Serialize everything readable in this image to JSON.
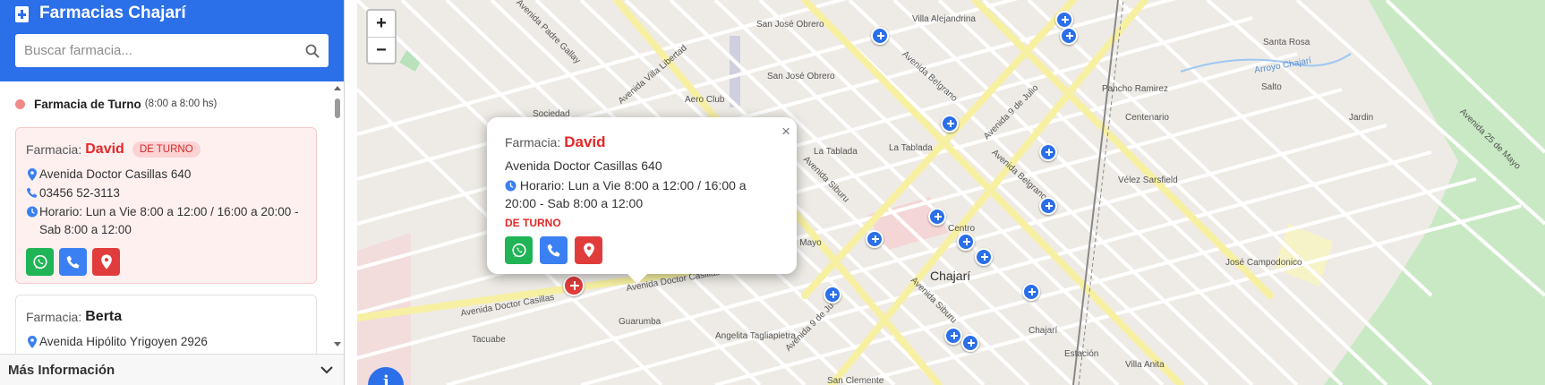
{
  "sidebar": {
    "title": "Farmacias Chajarí",
    "search_placeholder": "Buscar farmacia...",
    "legend": {
      "label": "Farmacia de Turno",
      "hours": "(8:00 a 8:00 hs)"
    },
    "cards": [
      {
        "prefix": "Farmacia:",
        "name": "David",
        "badge": "DE TURNO",
        "address": "Avenida Doctor Casillas 640",
        "phone": "03456 52-3113",
        "hours_line1": "Horario: Lun a Vie 8:00 a 12:00 / 16:00 a 20:00 -",
        "hours_line2": "Sab 8:00 a 12:00"
      },
      {
        "prefix": "Farmacia:",
        "name": "Berta",
        "address": "Avenida Hipólito Yrigoyen 2926"
      }
    ],
    "more_info": "Más Información"
  },
  "map": {
    "zoom_in": "+",
    "zoom_out": "−",
    "info_button": "i",
    "labels": {
      "villa_alejandrina": "Villa Alejandrina",
      "san_jose_obrero_1": "San José Obrero",
      "san_jose_obrero_2": "San José Obrero",
      "aero_club": "Aero Club",
      "sociedad": "Sociedad",
      "santa_rosa": "Santa Rosa",
      "pancho_ramirez": "Pancho Ramirez",
      "salto": "Salto",
      "jardin": "Jardin",
      "centenario": "Centenario",
      "velez": "Vélez Sarsfield",
      "la_tablada_1": "La Tablada",
      "la_tablada_2": "La Tablada",
      "centro": "Centro",
      "chajari": "Chajarí",
      "chajari_station": "Chajarí",
      "estacion": "Estación",
      "villa_anita": "Villa Anita",
      "jose_campodonico": "José Campodonico",
      "angelita": "Angelita Tagliapietra",
      "guarumba": "Guarumba",
      "san_clemente": "San Clemente",
      "primero_mayo": "1 de Mayo",
      "arroyo_chajari": "Arroyo Chajarí",
      "av_casillas_1": "Avenida Doctor Casillas",
      "av_casillas_2": "Avenida Doctor Casillas",
      "av_belgrano_1": "Avenida Belgrano",
      "av_belgrano_2": "Avenida Belgrano",
      "av_9_julio_1": "Avenida 9 de Julio",
      "av_9_julio_2": "Avenida 9 de Ju",
      "av_siburu_1": "Avenida Siburu",
      "av_siburu_2": "Avenida Siburu",
      "av_villa_libertad": "Avenida Villa Libertad",
      "av_25_mayo": "Avenida 25 de Mayo",
      "av_padre_gallay": "Avenida Padre Gallay",
      "tacuabe": "Tacuabe"
    },
    "popup": {
      "prefix": "Farmacia:",
      "name": "David",
      "address": "Avenida Doctor Casillas 640",
      "hours_line1": "Horario: Lun a Vie 8:00 a 12:00 / 16:00 a",
      "hours_line2": "20:00 - Sab 8:00 a 12:00",
      "status": "DE TURNO",
      "close": "×"
    }
  },
  "colors": {
    "brand_blue": "#2b6fe9",
    "duty_red": "#e52727",
    "whatsapp_green": "#20b456",
    "phone_blue": "#3b80f2",
    "location_red": "#e13c3c"
  },
  "icons": [
    "plus-square-icon",
    "search-icon",
    "map-pin-icon",
    "phone-icon",
    "clock-icon",
    "whatsapp-icon",
    "chevron-down-icon",
    "info-icon",
    "close-icon"
  ]
}
